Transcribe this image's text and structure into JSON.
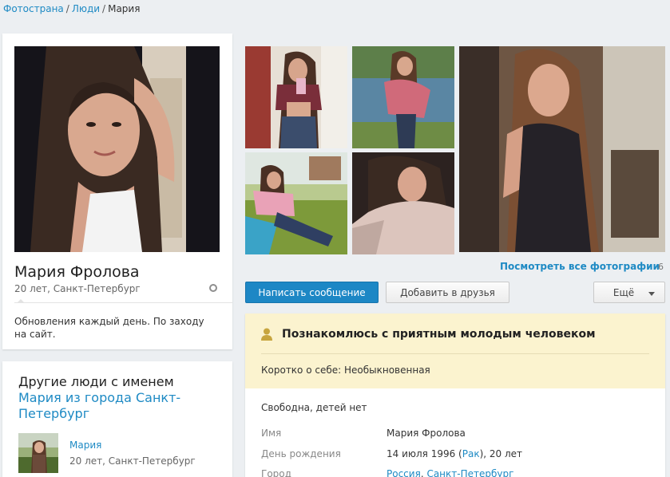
{
  "breadcrumb": {
    "home": "Фотострана",
    "people": "Люди",
    "current": "Мария",
    "separator": "/"
  },
  "profile": {
    "name": "Мария Фролова",
    "meta": "20 лет, Санкт-Петербург",
    "status": "Обновления каждый день. По заходу на сайт."
  },
  "others": {
    "title": "Другие люди с именем",
    "subtitle": "Мария из города Санкт-Петербург",
    "person": {
      "name": "Мария",
      "meta": "20 лет, Санкт-Петербург"
    }
  },
  "photos": {
    "all_label": "Посмотреть все фотографии",
    "count": "6"
  },
  "actions": {
    "message": "Написать сообщение",
    "add_friend": "Добавить в друзья",
    "more": "Ещё"
  },
  "info": {
    "intent": "Познакомлюсь с приятным молодым человеком",
    "about": "Коротко о себе: Необыкновенная",
    "family": "Свободна, детей нет",
    "rows": {
      "name_label": "Имя",
      "name_value": "Мария Фролова",
      "birthday_label": "День рождения",
      "birthday_date": "14 июля 1996",
      "birthday_sign": "Рак",
      "birthday_age": ", 20 лет",
      "city_label": "Город",
      "city_country": "Россия",
      "city_name": "Санкт-Петербург"
    }
  },
  "colors": {
    "link": "#1e8ac4",
    "primary_button": "#1d87c5",
    "intent_bg": "#fbf3cf",
    "page_bg": "#eceff2"
  }
}
